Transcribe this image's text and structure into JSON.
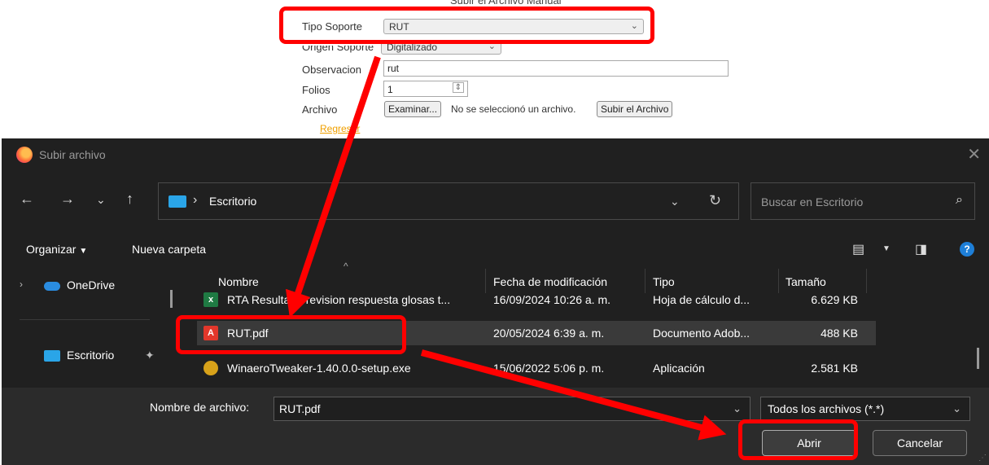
{
  "form": {
    "title": "Subir el Archivo Manual",
    "tipo_soporte": {
      "label": "Tipo Soporte",
      "value": "RUT"
    },
    "origen_soporte": {
      "label": "Origen Soporte",
      "value": "Digitalizado"
    },
    "observacion": {
      "label": "Observacion",
      "value": "rut"
    },
    "folios": {
      "label": "Folios",
      "value": "1"
    },
    "archivo": {
      "label": "Archivo",
      "browse_label": "Examinar...",
      "status": "No se seleccionó un archivo.",
      "upload_label": "Subir el Archivo"
    },
    "back_link": "Regresar"
  },
  "dialog": {
    "title": "Subir archivo",
    "address": {
      "path": "Escritorio"
    },
    "search": {
      "placeholder": "Buscar en Escritorio"
    },
    "toolbar": {
      "organize": "Organizar",
      "new_folder": "Nueva carpeta"
    },
    "sidebar": [
      {
        "label": "OneDrive",
        "icon": "cloud-icon"
      },
      {
        "label": "Escritorio",
        "icon": "folder-icon"
      }
    ],
    "columns": [
      "Nombre",
      "Fecha de modificación",
      "Tipo",
      "Tamaño"
    ],
    "files": [
      {
        "name": "RTA Resultado revision respuesta glosas t...",
        "date": "16/09/2024 10:26 a. m.",
        "type": "Hoja de cálculo d...",
        "size": "6.629 KB",
        "icon": "excel-icon",
        "icon_color": "#1f7a43"
      },
      {
        "name": "RUT.pdf",
        "date": "20/05/2024 6:39 a. m.",
        "type": "Documento Adob...",
        "size": "488 KB",
        "icon": "pdf-icon",
        "icon_color": "#e2372b"
      },
      {
        "name": "WinaeroTweaker-1.40.0.0-setup.exe",
        "date": "15/06/2022 5:06 p. m.",
        "type": "Aplicación",
        "size": "2.581 KB",
        "icon": "installer-icon",
        "icon_color": "#d8a21a"
      }
    ],
    "filename": {
      "label": "Nombre de archivo:",
      "value": "RUT.pdf"
    },
    "filter": {
      "value": "Todos los archivos (*.*)"
    },
    "open_label": "Abrir",
    "cancel_label": "Cancelar"
  },
  "colors": {
    "annotation": "#ff0000",
    "dialog_bg": "#202020",
    "link": "#f0a000"
  }
}
